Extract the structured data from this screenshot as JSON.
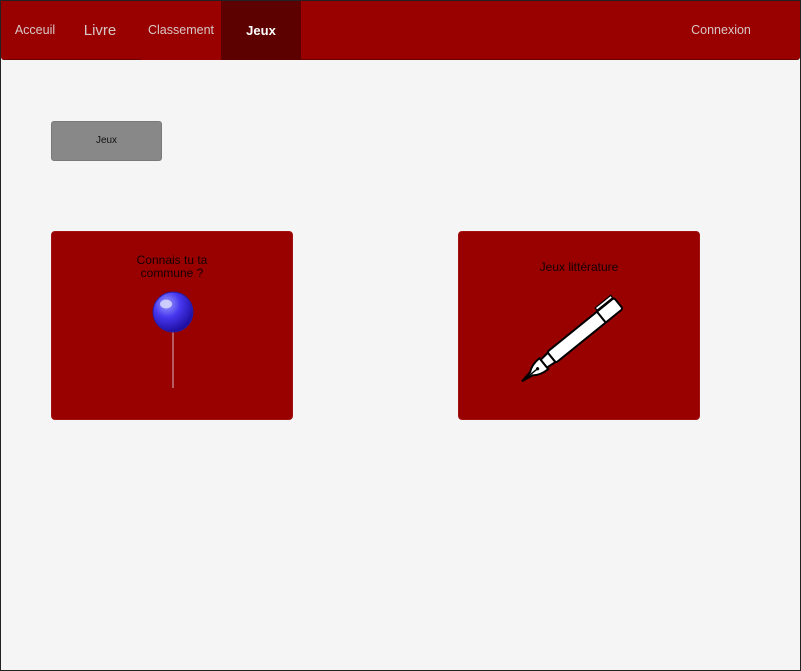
{
  "nav": {
    "acceuil": "Acceuil",
    "livre": "Livre",
    "classement": "Classement",
    "jeux": "Jeux",
    "connexion": "Connexion"
  },
  "main": {
    "section_button": "Jeux",
    "cards": [
      {
        "title": "Connais tu ta commune ?",
        "icon": "map-pin-icon"
      },
      {
        "title": "Jeux littérature",
        "icon": "fountain-pen-icon"
      }
    ]
  },
  "colors": {
    "navbar": "#990000",
    "nav_active": "#5c0000",
    "card": "#990000",
    "background": "#f5f5f5",
    "button": "#888888",
    "pin": "#3b2be0"
  }
}
